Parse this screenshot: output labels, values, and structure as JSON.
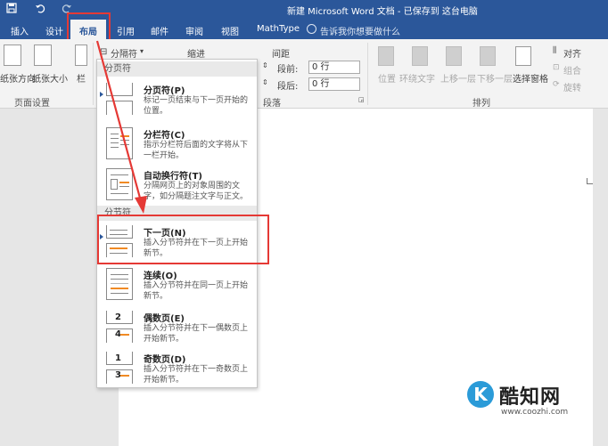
{
  "title_bar": {
    "title": "新建 Microsoft Word 文档 - 已保存到 这台电脑",
    "save_icon": "save-icon",
    "undo_icon": "undo-icon",
    "redo_icon": "redo-icon"
  },
  "tabs": [
    {
      "label": "插入"
    },
    {
      "label": "设计"
    },
    {
      "label": "布局",
      "active": true
    },
    {
      "label": "引用"
    },
    {
      "label": "邮件"
    },
    {
      "label": "审阅"
    },
    {
      "label": "视图"
    },
    {
      "label": "MathType"
    }
  ],
  "tell_me": "告诉我你想要做什么",
  "ribbon": {
    "page_setup": {
      "orientation_label": "纸张方向",
      "size_label": "纸张大小",
      "columns_label": "栏",
      "group_label": "页面设置"
    },
    "breaks_button": "分隔符",
    "indent_label": "缩进",
    "spacing": {
      "label": "间距",
      "before_label": "段前:",
      "before_value": "0 行",
      "after_label": "段后:",
      "after_value": "0 行"
    },
    "paragraph_group_label": "段落",
    "arrange": {
      "position_label": "位置",
      "wrap_label": "环绕文字",
      "forward_label": "上移一层",
      "backward_label": "下移一层",
      "selection_pane_label": "选择窗格",
      "align_label": "对齐",
      "group_obj_label": "组合",
      "rotate_label": "旋转",
      "group_label": "排列"
    }
  },
  "breaks_menu": {
    "page_breaks_header": "分页符",
    "section_breaks_header": "分节符",
    "items": [
      {
        "title": "分页符(P)",
        "desc": "标记一页结束与下一页开始的位置。"
      },
      {
        "title": "分栏符(C)",
        "desc": "指示分栏符后面的文字将从下一栏开始。"
      },
      {
        "title": "自动换行符(T)",
        "desc": "分隔网页上的对象周围的文字，如分隔题注文字与正文。"
      },
      {
        "title": "下一页(N)",
        "desc": "插入分节符并在下一页上开始新节。"
      },
      {
        "title": "连续(O)",
        "desc": "插入分节符并在同一页上开始新节。"
      },
      {
        "title": "偶数页(E)",
        "desc": "插入分节符并在下一偶数页上开始新节。",
        "icon_number": "2",
        "icon_number2": "4"
      },
      {
        "title": "奇数页(D)",
        "desc": "插入分节符并在下一奇数页上开始新节。",
        "icon_number": "1",
        "icon_number2": "3"
      }
    ]
  },
  "watermark": {
    "logo_letter": "K",
    "name": "酷知网",
    "url": "www.coozhi.com"
  },
  "colors": {
    "accent": "#2b579a",
    "highlight": "#e53935",
    "icon_orange": "#f08a24"
  }
}
